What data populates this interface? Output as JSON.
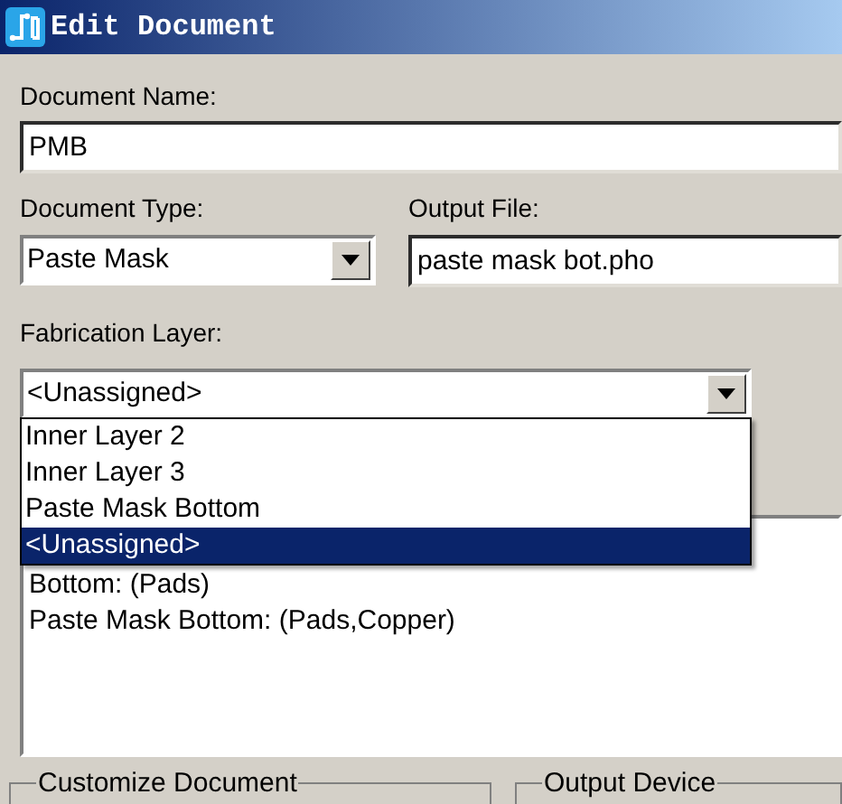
{
  "window": {
    "title": "Edit Document"
  },
  "document_name": {
    "label": "Document Name:",
    "value": "PMB"
  },
  "document_type": {
    "label": "Document Type:",
    "value": "Paste Mask"
  },
  "output_file": {
    "label": "Output File:",
    "value": "paste mask bot.pho"
  },
  "fabrication_layer": {
    "label": "Fabrication Layer:",
    "value": "<Unassigned>",
    "expanded": true,
    "options": [
      {
        "label": "Inner Layer 2",
        "selected": false
      },
      {
        "label": "Inner Layer 3",
        "selected": false
      },
      {
        "label": "Paste Mask Bottom",
        "selected": false
      },
      {
        "label": "<Unassigned>",
        "selected": true
      }
    ]
  },
  "layers_list": {
    "items": [
      "Bottom: (Pads)",
      "Paste Mask Bottom: (Pads,Copper)"
    ]
  },
  "groups": [
    "Customize Document",
    "Output Device"
  ]
}
